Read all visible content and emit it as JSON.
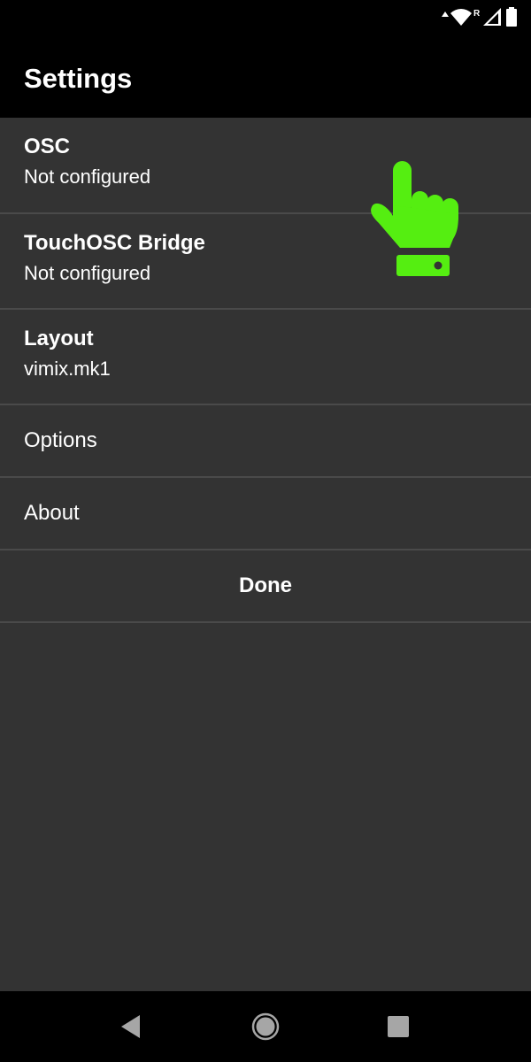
{
  "status_bar": {
    "icons": [
      "wifi-icon",
      "roaming-indicator-icon",
      "cellular-signal-icon",
      "battery-icon"
    ],
    "roaming_label": "R"
  },
  "app_bar": {
    "title": "Settings"
  },
  "settings": {
    "items": [
      {
        "title": "OSC",
        "summary": "Not configured"
      },
      {
        "title": "TouchOSC Bridge",
        "summary": "Not configured"
      },
      {
        "title": "Layout",
        "summary": "vimix.mk1"
      }
    ],
    "options_label": "Options",
    "about_label": "About",
    "done_label": "Done"
  },
  "overlay": {
    "icon": "hand-pointer-icon",
    "color": "#55ee11"
  },
  "nav_bar": {
    "buttons": [
      "back-icon",
      "home-icon",
      "recents-icon"
    ]
  }
}
